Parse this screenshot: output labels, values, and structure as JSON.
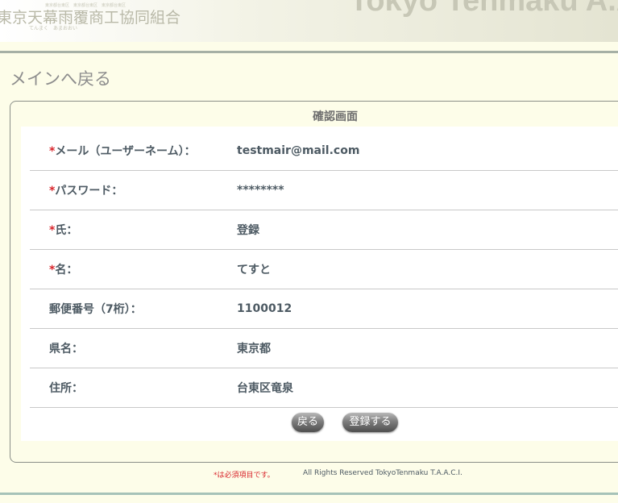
{
  "header": {
    "org_name": "東京天幕雨覆商工協同組合",
    "tagline": "てんまく　あまおおい",
    "small_text": "東京都台東区　東京都台東区　東京都台東区",
    "brand": "Tokyo Tenmaku A.A"
  },
  "nav": {
    "back_to_main": "メインへ戻る"
  },
  "confirm": {
    "title": "確認画面",
    "rows": [
      {
        "required_mark": "*",
        "label": "メール（ユーザーネーム）：",
        "value": "testmair@mail.com"
      },
      {
        "required_mark": "*",
        "label": "パスワード：",
        "value": "********"
      },
      {
        "required_mark": "*",
        "label": "氏：",
        "value": "登録"
      },
      {
        "required_mark": "*",
        "label": "名：",
        "value": "てすと"
      },
      {
        "required_mark": "",
        "label": "郵便番号（7桁）：",
        "value": "1100012"
      },
      {
        "required_mark": "",
        "label": "県名：",
        "value": "東京都"
      },
      {
        "required_mark": "",
        "label": "住所：",
        "value": "台東区竜泉"
      }
    ],
    "back_button": "戻る",
    "register_button": "登録する"
  },
  "footer": {
    "required_note": "*は必須項目です。",
    "copyright": "All Rights Reserved TokyoTenmaku T.A.A.C.I."
  }
}
